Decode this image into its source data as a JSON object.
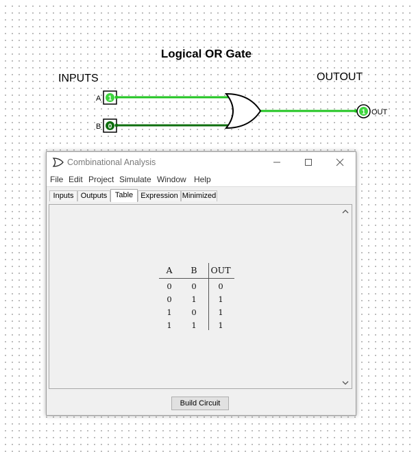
{
  "circuit": {
    "title": "Logical OR Gate",
    "inputs_label": "INPUTS",
    "outputs_label": "OUTOUT",
    "input_a": {
      "name": "A",
      "value": "1"
    },
    "input_b": {
      "name": "B",
      "value": "0"
    },
    "output": {
      "name": "OUT",
      "value": "1"
    },
    "colors": {
      "wire_high": "#22c422",
      "wire_low": "#0e6e0e",
      "pin_high": "#3fd43f"
    }
  },
  "window": {
    "title": "Combinational Analysis",
    "icon": "or-gate-icon",
    "controls": [
      "minimize-icon",
      "maximize-icon",
      "close-icon"
    ],
    "menu": [
      "File",
      "Edit",
      "Project",
      "Simulate",
      "Window",
      "Help"
    ],
    "tabs": [
      {
        "label": "Inputs",
        "active": false
      },
      {
        "label": "Outputs",
        "active": false
      },
      {
        "label": "Table",
        "active": true
      },
      {
        "label": "Expression",
        "active": false
      },
      {
        "label": "Minimized",
        "active": false
      }
    ],
    "truth_table": {
      "headers": [
        "A",
        "B",
        "OUT"
      ],
      "rows": [
        [
          "0",
          "0",
          "0"
        ],
        [
          "0",
          "1",
          "1"
        ],
        [
          "1",
          "0",
          "1"
        ],
        [
          "1",
          "1",
          "1"
        ]
      ]
    },
    "build_button": "Build Circuit"
  }
}
